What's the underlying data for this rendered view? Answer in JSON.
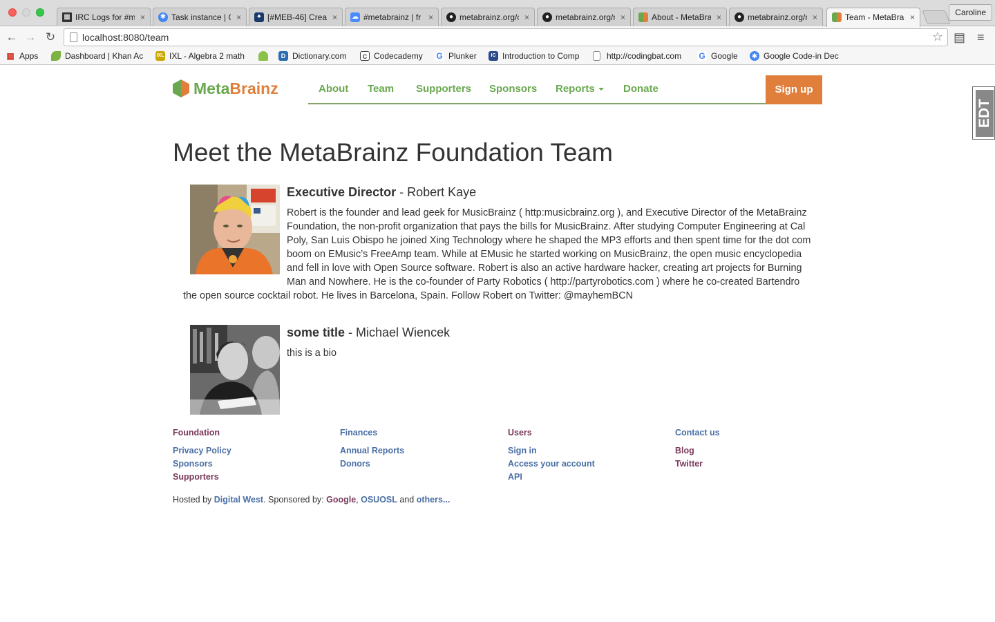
{
  "browser": {
    "tabs": [
      {
        "label": "IRC Logs for #m",
        "icon": "irc-log-favicon",
        "color": "#333333"
      },
      {
        "label": "Task instance | G",
        "icon": "google-codein-favicon",
        "color": "#4285f4"
      },
      {
        "label": "[#MEB-46] Crea",
        "icon": "jira-favicon",
        "color": "#1a3a6b"
      },
      {
        "label": "#metabrainz | fr",
        "icon": "chat-favicon",
        "color": "#4a8cff"
      },
      {
        "label": "metabrainz.org/c",
        "icon": "github-favicon",
        "color": "#222222"
      },
      {
        "label": "metabrainz.org/r",
        "icon": "github-favicon",
        "color": "#222222"
      },
      {
        "label": "About - MetaBra",
        "icon": "metabrainz-favicon",
        "color": "#e07f3c"
      },
      {
        "label": "metabrainz.org/r",
        "icon": "github-favicon",
        "color": "#222222"
      },
      {
        "label": "Team - MetaBrai",
        "icon": "metabrainz-favicon",
        "color": "#e07f3c"
      }
    ],
    "close_glyph": "×",
    "profile_name": "Caroline",
    "url": "localhost:8080/team",
    "bookmarks": [
      {
        "label": "Apps",
        "icon": "apps-grid-icon",
        "color": "#d23f31"
      },
      {
        "label": "Dashboard | Khan Ac",
        "icon": "khan-academy-icon",
        "color": "#7cb342"
      },
      {
        "label": "IXL - Algebra 2 math",
        "icon": "ixl-icon",
        "color": "#c9a800"
      },
      {
        "label": "",
        "icon": "android-icon",
        "color": "#8bc34a"
      },
      {
        "label": "Dictionary.com",
        "icon": "dictionary-icon",
        "color": "#2b6cb0"
      },
      {
        "label": "Codecademy",
        "icon": "codecademy-icon",
        "color": "#444444"
      },
      {
        "label": "Plunker",
        "icon": "google-icon",
        "color": "#4285f4"
      },
      {
        "label": "Introduction to Comp",
        "icon": "course-icon",
        "color": "#2a4a8a"
      },
      {
        "label": "http://codingbat.com",
        "icon": "page-icon",
        "color": "#888888"
      },
      {
        "label": "Google",
        "icon": "google-icon",
        "color": "#4285f4"
      },
      {
        "label": "Google Code-in Dec",
        "icon": "google-codein-icon",
        "color": "#4285f4"
      }
    ]
  },
  "site": {
    "logo": {
      "meta": "Meta",
      "brainz": "Brainz"
    },
    "nav": {
      "about": "About",
      "team": "Team",
      "supporters": "Supporters",
      "sponsors": "Sponsors",
      "reports": "Reports",
      "donate": "Donate",
      "signup": "Sign up"
    },
    "edt_label": "EDT",
    "title": "Meet the MetaBrainz Foundation Team",
    "members": [
      {
        "role": "Executive Director",
        "separator": " - ",
        "name": "Robert Kaye",
        "bio": "Robert is the founder and lead geek for MusicBrainz ( http:musicbrainz.org ), and Executive Director of the MetaBrainz Foundation, the non-profit organization that pays the bills for MusicBrainz. After studying Computer Engineering at Cal Poly, San Luis Obispo he joined Xing Technology where he shaped the MP3 efforts and then spent time for the dot com boom on EMusic’s FreeAmp team. While at EMusic he started working on MusicBrainz, the open music encyclopedia and fell in love with Open Source software. Robert is also an active hardware hacker, creating art projects for Burning Man and Nowhere. He is the co-founder of Party Robotics ( http://partyrobotics.com ) where he co-created Bartendro the open source cocktail robot. He lives in Barcelona, Spain. Follow Robert on Twitter: @mayhemBCN"
      },
      {
        "role": "some title",
        "separator": " - ",
        "name": "Michael Wiencek",
        "bio": "this is a bio"
      }
    ],
    "footer": {
      "foundation": {
        "heading": "Foundation",
        "links": [
          "Privacy Policy",
          "Sponsors",
          "Supporters"
        ]
      },
      "finances": {
        "heading": "Finances",
        "links": [
          "Annual Reports",
          "Donors"
        ]
      },
      "users": {
        "heading": "Users",
        "links": [
          "Sign in",
          "Access your account",
          "API"
        ]
      },
      "contact": {
        "heading": "Contact us",
        "links": [
          "Blog",
          "Twitter"
        ]
      },
      "hosted": {
        "prefix": "Hosted by ",
        "host": "Digital West",
        "middle": ". Sponsored by: ",
        "sponsor1": "Google",
        "comma": ", ",
        "sponsor2": "OSUOSL",
        "and": " and ",
        "others": "others..."
      }
    },
    "colors": {
      "green": "#6aa84f",
      "orange": "#e07f3c",
      "purple": "#7a3a5c",
      "blue": "#4a6fa5"
    }
  }
}
